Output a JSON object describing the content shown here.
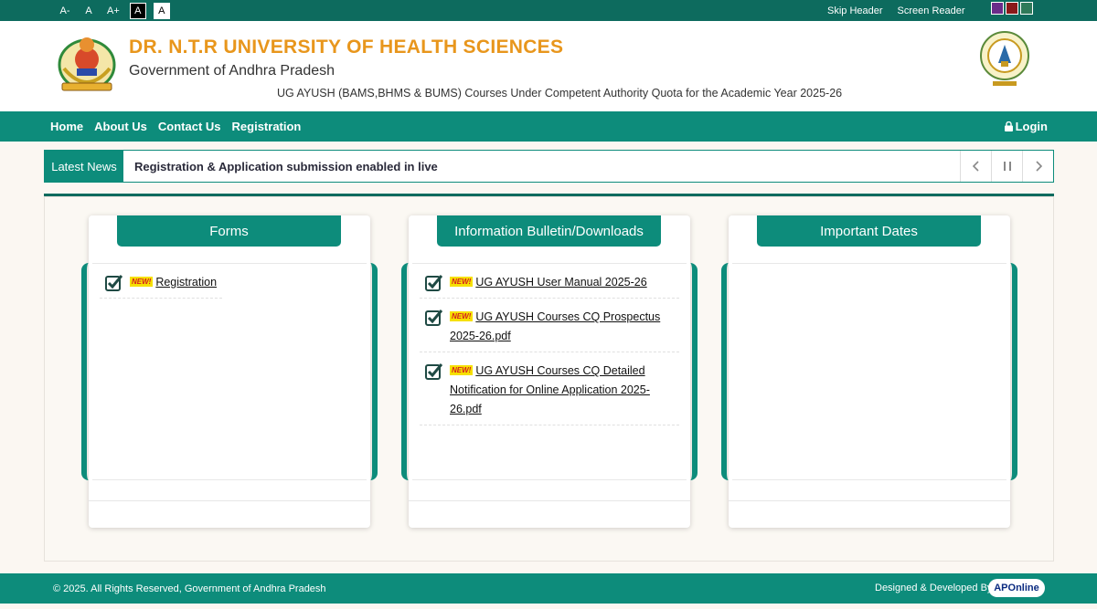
{
  "topbar": {
    "font_controls": [
      "A-",
      "A",
      "A+",
      "A",
      "A"
    ],
    "skip_header": "Skip Header",
    "screen_reader": "Screen Reader",
    "theme_colors": [
      "#6a2c8a",
      "#8a1a1a",
      "#2f7a5a"
    ]
  },
  "header": {
    "university": "DR. N.T.R UNIVERSITY OF HEALTH SCIENCES",
    "government": "Government of Andhra Pradesh",
    "course_line": "UG AYUSH (BAMS,BHMS & BUMS) Courses Under Competent Authority Quota for the Academic Year 2025-26"
  },
  "nav": {
    "items": [
      "Home",
      "About Us",
      "Contact Us",
      "Registration"
    ],
    "login": "Login"
  },
  "news": {
    "label": "Latest News",
    "text": "Registration & Application submission enabled in live"
  },
  "cards": {
    "forms": {
      "title": "Forms",
      "items": [
        {
          "badge": "NEW!",
          "text": "Registration"
        }
      ]
    },
    "bulletin": {
      "title": "Information Bulletin/Downloads",
      "items": [
        {
          "badge": "NEW!",
          "text": "UG AYUSH User Manual 2025-26"
        },
        {
          "badge": "NEW!",
          "text": "UG AYUSH Courses CQ Prospectus 2025-26.pdf"
        },
        {
          "badge": "NEW!",
          "text": "UG AYUSH Courses CQ Detailed Notification for Online Application 2025-26.pdf"
        }
      ]
    },
    "dates": {
      "title": "Important Dates",
      "items": []
    }
  },
  "footer": {
    "copyright": "© 2025. All Rights Reserved, Government of Andhra Pradesh",
    "designed": "Designed & Developed By",
    "brand": "APOnline"
  },
  "colors": {
    "primary": "#0d8c7b",
    "dark": "#0d6b5e",
    "title_orange": "#e8961c"
  }
}
